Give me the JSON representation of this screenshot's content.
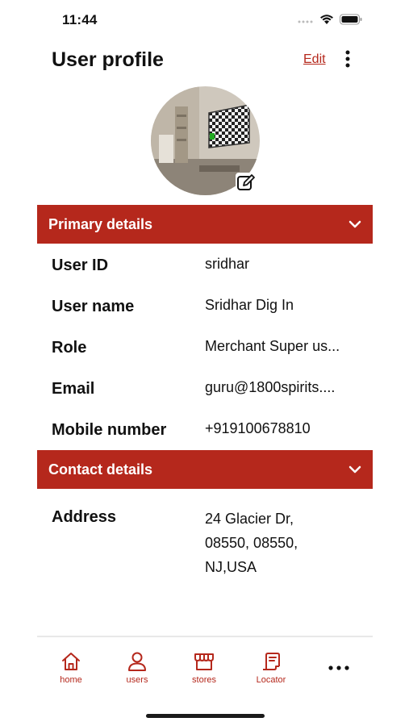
{
  "status_bar": {
    "time": "11:44"
  },
  "header": {
    "title": "User profile",
    "edit_label": "Edit"
  },
  "primary_section": {
    "title": "Primary details"
  },
  "primary_details": [
    {
      "label": "User ID",
      "value": "sridhar"
    },
    {
      "label": "User name",
      "value": "Sridhar  Dig In"
    },
    {
      "label": "Role",
      "value": "Merchant Super us..."
    },
    {
      "label": "Email",
      "value": "guru@1800spirits...."
    },
    {
      "label": "Mobile number",
      "value": "+919100678810"
    }
  ],
  "contact_section": {
    "title": "Contact details"
  },
  "contact_details": {
    "address_label": "Address",
    "address_lines": [
      "24 Glacier Dr,",
      "08550, 08550,",
      "NJ,USA"
    ]
  },
  "tabbar": {
    "items": [
      {
        "label": "home",
        "icon": "home-icon"
      },
      {
        "label": "users",
        "icon": "user-icon"
      },
      {
        "label": "stores",
        "icon": "store-icon"
      },
      {
        "label": "Locator",
        "icon": "locator-icon"
      },
      {
        "label": "",
        "icon": "more-horizontal-icon"
      }
    ]
  },
  "colors": {
    "accent": "#b5281c",
    "background": "#ffffff",
    "text": "#111111"
  }
}
